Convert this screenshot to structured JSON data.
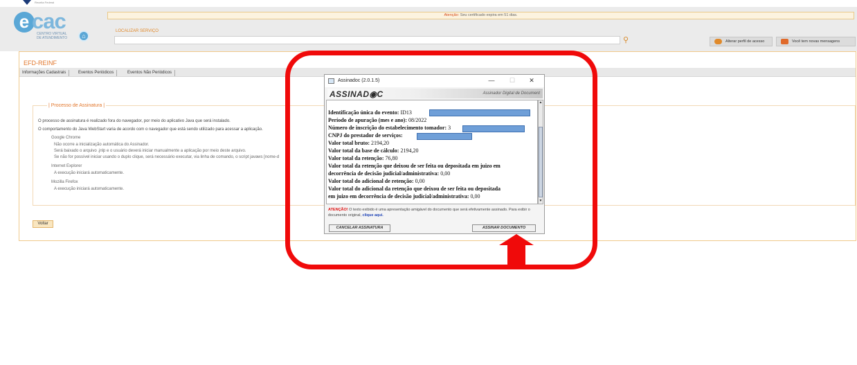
{
  "header": {
    "top_text": "Receita Federal",
    "logo": {
      "mark": "e",
      "name": "cac",
      "subtitle_line1": "CENTRO VIRTUAL",
      "subtitle_line2": "DE ATENDIMENTO"
    },
    "home_icon": "home-icon",
    "alert": {
      "prefix": "Atenção:",
      "text": "Seu certificado expira em 51 dias."
    },
    "search": {
      "label": "LOCALIZAR SERVIÇO",
      "value": "",
      "icon": "search-icon"
    },
    "buttons": {
      "profile": "Alterar perfil de acesso",
      "messages": "Você tem novas mensagens"
    }
  },
  "page": {
    "title": "EFD-REINF",
    "tabs": [
      "Informações Cadastrais",
      "Eventos Periódicos",
      "Eventos Não Periódicos"
    ],
    "section_legend": "| Processo de Assinatura |",
    "lines": {
      "l1": "O processo de assinatura é realizado fora do navegador, por meio do aplicativo Java que será instalado.",
      "l2": "O comportamento do Java WebStart varia de acordo com o navegador que está sendo utilizado para acessar a aplicação.",
      "chrome_title": "Google Chrome",
      "chrome_1": "Não ocorre a inicialização automática do Assinador.",
      "chrome_2": "Será baixado o arquivo .jnlp e o usuário deverá iniciar manualmente a aplicação por meio deste arquivo.",
      "chrome_3": "Se não for possível iniciar usando o duplo clique, será necessário executar, via linha de comando, o script javaws [nome-d",
      "ie_title": "Internet Explorer",
      "ie_1": "A execução iniciará automaticamente.",
      "ff_title": "Mozilla Firefox",
      "ff_1": "A execução iniciará automaticamente."
    },
    "back_button": "Voltar"
  },
  "dialog": {
    "title": "Assinadoc (2.0.1.5)",
    "controls": {
      "minimize": "—",
      "maximize": "☐",
      "close": "✕"
    },
    "brand": "ASSINAD",
    "brand_suffix": "C",
    "tagline": "Assinador Digital de Document",
    "fields": [
      {
        "label": "Identificação única do evento:",
        "value": "ID13"
      },
      {
        "label": "Período de apuração (mes e ano):",
        "value": "08/2022"
      },
      {
        "label": "Número de inscrição do estabelecimento tomador:",
        "value": "3"
      },
      {
        "label": "CNPJ do prestador de serviços:",
        "value": ""
      },
      {
        "label": "Valor total bruto:",
        "value": "2194,20"
      },
      {
        "label": "Valor total da base de cálculo:",
        "value": "2194,20"
      },
      {
        "label": "Valor total da retenção:",
        "value": "76,80"
      },
      {
        "label": "Valor total da retenção que deixou de ser feita ou depositada em juizo em",
        "value": ""
      },
      {
        "label": "decorrência de decisão judicial/administrativa:",
        "value": "0,00"
      },
      {
        "label": "Valor total do adicional de retenção:",
        "value": "0,00"
      },
      {
        "label": "Valor total do adicional da retenção que deixou de ser feita ou depositada",
        "value": ""
      },
      {
        "label": "em juizo em decorrência de decisão judicial/administrativa:",
        "value": "0,00"
      }
    ],
    "warning": {
      "label": "ATENÇÃO!",
      "text": "O texto exibido é uma apresentação amigável do documento que será efetivamente assinado. Para exibir o documento original,",
      "link": "clique aqui."
    },
    "cancel_button": "CANCELAR ASSINATURA",
    "sign_button": "ASSINAR DOCUMENTO"
  },
  "colors": {
    "accent_orange": "#e2762b",
    "annotation_red": "#f00a0a",
    "redaction_blue": "#6f9fd8"
  }
}
